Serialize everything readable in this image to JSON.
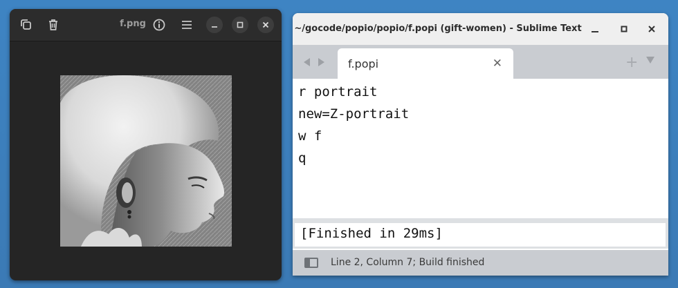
{
  "viewer": {
    "title": "f.png"
  },
  "sublime": {
    "window_title": "~/gocode/popio/popio/f.popi (gift-women) - Sublime Text",
    "tab_label": "f.popi",
    "tab_close": "✕",
    "new_tab": "+",
    "code_lines": [
      "r portrait",
      "new=Z-portrait",
      "w f",
      "q"
    ],
    "build_output": "[Finished in 29ms]",
    "status": "Line 2, Column 7; Build finished"
  }
}
